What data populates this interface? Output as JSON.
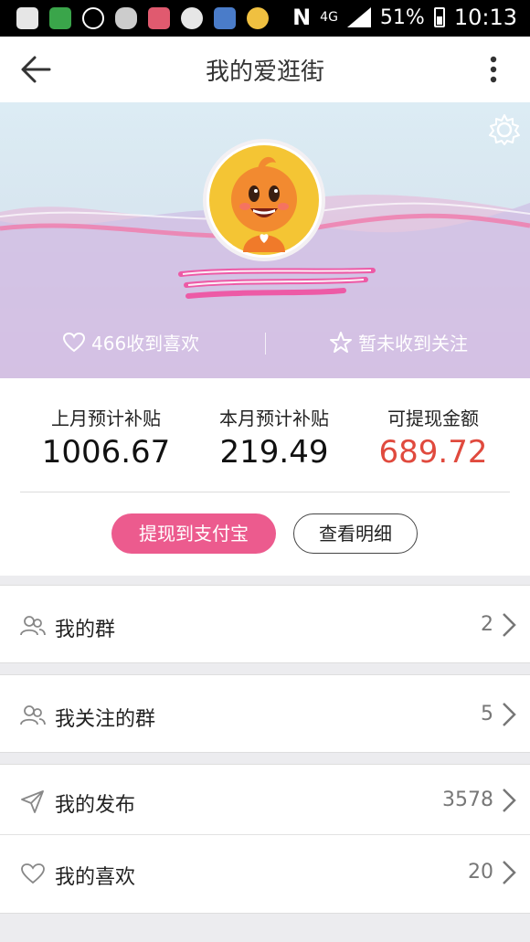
{
  "status_bar": {
    "network": "4G",
    "battery": "51%",
    "time": "10:13"
  },
  "header": {
    "title": "我的爱逛街"
  },
  "profile": {
    "likes_received": "466收到喜欢",
    "follows_received": "暂未收到关注"
  },
  "subsidy": {
    "last_month_label": "上月预计补贴",
    "last_month_value": "1006.67",
    "this_month_label": "本月预计补贴",
    "this_month_value": "219.49",
    "withdrawable_label": "可提现金额",
    "withdrawable_value": "689.72",
    "withdraw_button": "提现到支付宝",
    "details_button": "查看明细"
  },
  "menu": [
    {
      "label": "我的群",
      "count": "2",
      "icon": "group-icon"
    },
    {
      "label": "我关注的群",
      "count": "5",
      "icon": "group-icon"
    },
    {
      "label": "我的发布",
      "count": "3578",
      "icon": "send-icon"
    },
    {
      "label": "我的喜欢",
      "count": "20",
      "icon": "heart-icon"
    }
  ],
  "colors": {
    "accent_pink": "#ec5b8e",
    "amount_red": "#e04a3e"
  }
}
